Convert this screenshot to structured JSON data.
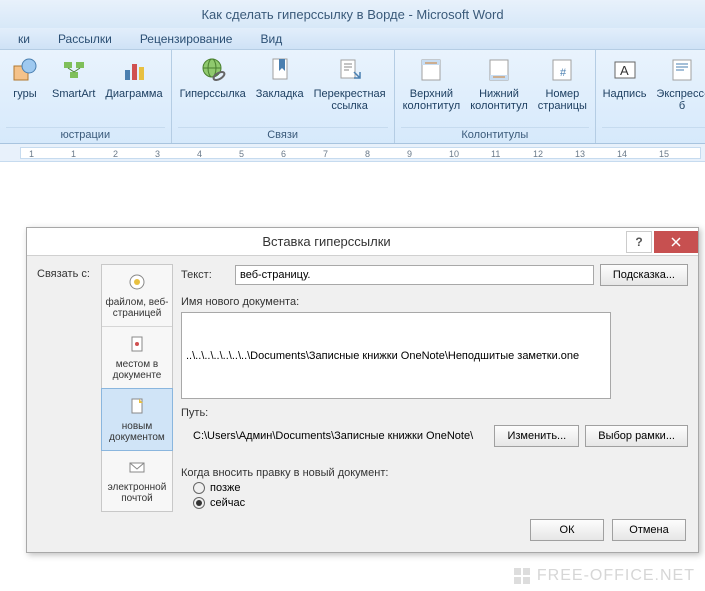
{
  "window": {
    "title": "Как сделать гиперссылку в Ворде - Microsoft Word"
  },
  "tabs": [
    "ки",
    "Рассылки",
    "Рецензирование",
    "Вид"
  ],
  "ribbon": {
    "group0": {
      "items": [
        {
          "label": "гуры"
        },
        {
          "label": "SmartArt"
        },
        {
          "label": "Диаграмма"
        }
      ],
      "caption": "юстрации"
    },
    "group1": {
      "items": [
        {
          "label": "Гиперссылка"
        },
        {
          "label": "Закладка"
        },
        {
          "label": "Перекрестная\nссылка"
        }
      ],
      "caption": "Связи"
    },
    "group2": {
      "items": [
        {
          "label": "Верхний\nколонтитул"
        },
        {
          "label": "Нижний\nколонтитул"
        },
        {
          "label": "Номер\nстраницы"
        }
      ],
      "caption": "Колонтитулы"
    },
    "group3": {
      "items": [
        {
          "label": "Надпись"
        },
        {
          "label": "Экспресс-б"
        }
      ],
      "caption": ""
    }
  },
  "ruler": {
    "marks": [
      "1",
      "1",
      "2",
      "3",
      "4",
      "5",
      "6",
      "7",
      "8",
      "9",
      "10",
      "11",
      "12",
      "13",
      "14",
      "15"
    ]
  },
  "dialog": {
    "title": "Вставка гиперссылки",
    "link_with_label": "Связать с:",
    "sidebar": [
      {
        "label": "файлом, веб-\nстраницей"
      },
      {
        "label": "местом в\nдокументе"
      },
      {
        "label": "новым\nдокументом"
      },
      {
        "label": "электронной\nпочтой"
      }
    ],
    "text_label": "Текст:",
    "text_value": "веб-страницу.",
    "hint_btn": "Подсказка...",
    "newdoc_label": "Имя нового документа:",
    "newdoc_value": "..\\..\\..\\..\\..\\..\\..\\Documents\\Записные книжки OneNote\\Неподшитые заметки.one",
    "path_label": "Путь:",
    "path_value": "C:\\Users\\Админ\\Documents\\Записные книжки OneNote\\",
    "change_btn": "Изменить...",
    "frame_btn": "Выбор рамки...",
    "when_label": "Когда вносить правку в новый документ:",
    "radio_later": "позже",
    "radio_now": "сейчас",
    "ok": "ОК",
    "cancel": "Отмена"
  },
  "watermark": "FREE-OFFICE.NET"
}
